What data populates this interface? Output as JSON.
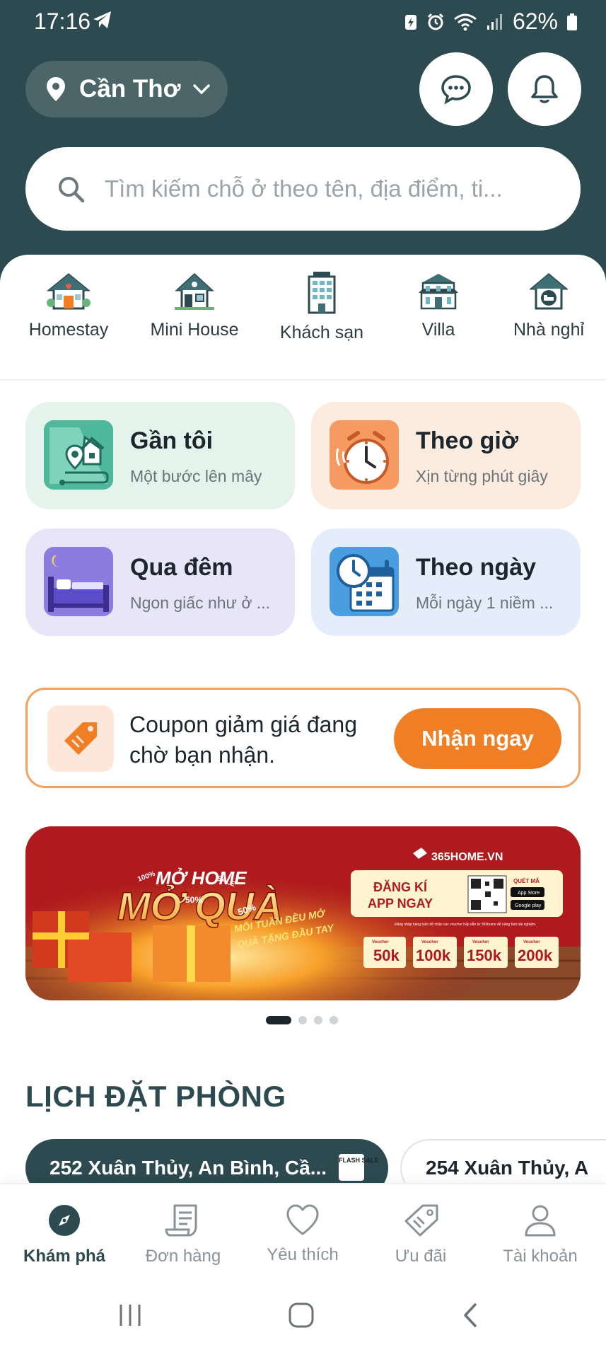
{
  "status_bar": {
    "time": "17:16",
    "battery": "62%"
  },
  "header": {
    "location": "Cần Thơ",
    "search_placeholder": "Tìm kiếm chỗ ở theo tên, địa điểm, ti..."
  },
  "categories": [
    {
      "label": "Homestay",
      "icon": "homestay-icon"
    },
    {
      "label": "Mini House",
      "icon": "mini-house-icon"
    },
    {
      "label": "Khách sạn",
      "icon": "hotel-icon"
    },
    {
      "label": "Villa",
      "icon": "villa-icon"
    },
    {
      "label": "Nhà nghỉ",
      "icon": "motel-icon"
    }
  ],
  "quick_options": [
    {
      "title": "Gần tôi",
      "subtitle": "Một bước lên mây",
      "icon": "map-pin-house-icon",
      "bg": "#e4f3ec"
    },
    {
      "title": "Theo giờ",
      "subtitle": "Xịn từng phút giây",
      "icon": "alarm-clock-icon",
      "bg": "#fcebdf"
    },
    {
      "title": "Qua đêm",
      "subtitle": "Ngon giấc như ở ...",
      "icon": "bed-moon-icon",
      "bg": "#e8e5f9"
    },
    {
      "title": "Theo ngày",
      "subtitle": "Mỗi ngày 1 niềm ...",
      "icon": "calendar-clock-icon",
      "bg": "#e4eefa"
    }
  ],
  "coupon": {
    "text": "Coupon giảm giá đang chờ bạn nhận.",
    "button": "Nhận ngay"
  },
  "banner": {
    "headline_top": "MỞ HOME",
    "headline_main": "MỞ QUÀ",
    "tagline_1": "MỖI TUẦN ĐỀU MỞ",
    "tagline_2": "QUÀ TẶNG ĐẦU TAY",
    "brand": "365HOME.VN",
    "cta": "ĐĂNG KÍ APP NGAY",
    "qr_label": "QUÉT MÃ",
    "note": "Đăng nhập hàng tuần để nhận các voucher hấp dẫn từ 365home để nâng tầm trải nghiệm.",
    "vouchers": [
      "50k",
      "100k",
      "150k",
      "200k"
    ],
    "voucher_label": "Voucher",
    "percent": "50%",
    "percent_small": "100%",
    "sale_tag": "SALE",
    "app_store": "App Store",
    "google_play": "Google play",
    "page_count": 4,
    "active_page": 1
  },
  "booking_section": {
    "title": "LỊCH ĐẶT PHÒNG",
    "items": [
      {
        "address": "252 Xuân Thủy,  An Bình, Cầ...",
        "badge": "FLASH SALE"
      },
      {
        "address": "254 Xuân Thủy, A"
      }
    ]
  },
  "bottom_nav": [
    {
      "label": "Khám phá",
      "icon": "compass-icon",
      "active": true
    },
    {
      "label": "Đơn hàng",
      "icon": "receipt-icon",
      "active": false
    },
    {
      "label": "Yêu thích",
      "icon": "heart-icon",
      "active": false
    },
    {
      "label": "Ưu đãi",
      "icon": "tag-icon",
      "active": false
    },
    {
      "label": "Tài khoản",
      "icon": "user-icon",
      "active": false
    }
  ],
  "colors": {
    "primary": "#2c4a4f",
    "accent": "#f07e24"
  }
}
